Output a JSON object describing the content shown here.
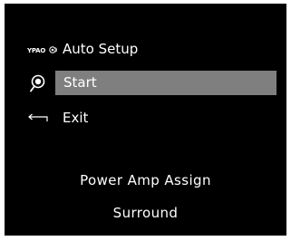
{
  "menu": {
    "header": {
      "icon": "ypao-icon",
      "icon_text": "YPAO",
      "label": "Auto Setup"
    },
    "items": [
      {
        "icon": "microphone-icon",
        "label": "Start",
        "selected": true
      },
      {
        "icon": "return-arrow-icon",
        "label": "Exit",
        "selected": false
      }
    ]
  },
  "status": {
    "title": "Power Amp Assign",
    "value": "Surround"
  },
  "colors": {
    "background": "#000000",
    "text": "#ffffff",
    "highlight": "#7f7f7f"
  }
}
